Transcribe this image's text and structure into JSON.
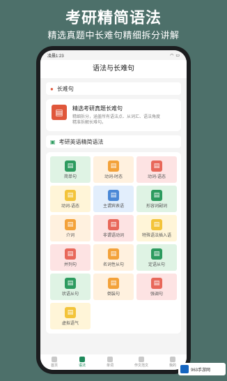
{
  "promo": {
    "title": "考研精简语法",
    "subtitle": "精选真题中长难句精细拆分讲解"
  },
  "status": {
    "time": "凌晨1:23",
    "wifi": "wifi-icon",
    "battery": "battery-icon"
  },
  "nav": {
    "title": "语法与长难句"
  },
  "section1": {
    "label": "长难句"
  },
  "card": {
    "title": "精选考研真题长难句",
    "desc": "精细拆分，涵盖所有语法点、从词汇、语法角度精准拆解长难句。"
  },
  "section2": {
    "label": "考研英语精简语法"
  },
  "tiles": [
    {
      "label": "简单句",
      "bg": "#dff3e4",
      "icon": "#2d9b5f"
    },
    {
      "label": "动词-时态",
      "bg": "#fff1df",
      "icon": "#f3a23a"
    },
    {
      "label": "动词-语态",
      "bg": "#fde3e3",
      "icon": "#e8685a"
    },
    {
      "label": "动词-语态",
      "bg": "#fff5d8",
      "icon": "#f3c43a"
    },
    {
      "label": "主谓宾表语",
      "bg": "#e2eefc",
      "icon": "#4a88d6"
    },
    {
      "label": "形容词副词",
      "bg": "#dff3e4",
      "icon": "#2d9b5f"
    },
    {
      "label": "介词",
      "bg": "#fff1df",
      "icon": "#f3a23a"
    },
    {
      "label": "非谓语动词",
      "bg": "#fde3e3",
      "icon": "#e8685a"
    },
    {
      "label": "特殊语法插入语",
      "bg": "#fff5d8",
      "icon": "#f3c43a"
    },
    {
      "label": "并列句",
      "bg": "#fde3e3",
      "icon": "#e8685a"
    },
    {
      "label": "名词性从句",
      "bg": "#fff1df",
      "icon": "#f3a23a"
    },
    {
      "label": "定语从句",
      "bg": "#dff3e4",
      "icon": "#2d9b5f"
    },
    {
      "label": "状语从句",
      "bg": "#dff3e4",
      "icon": "#2d9b5f"
    },
    {
      "label": "倒装句",
      "bg": "#fff1df",
      "icon": "#f3a23a"
    },
    {
      "label": "强调句",
      "bg": "#fde3e3",
      "icon": "#e8685a"
    },
    {
      "label": "虚拟语气",
      "bg": "#fff5d8",
      "icon": "#f3c43a"
    }
  ],
  "tabs": [
    {
      "label": "首页"
    },
    {
      "label": "语法"
    },
    {
      "label": "单词"
    },
    {
      "label": "作文范文"
    },
    {
      "label": "我的"
    }
  ],
  "watermark": {
    "text": "963手游网"
  }
}
